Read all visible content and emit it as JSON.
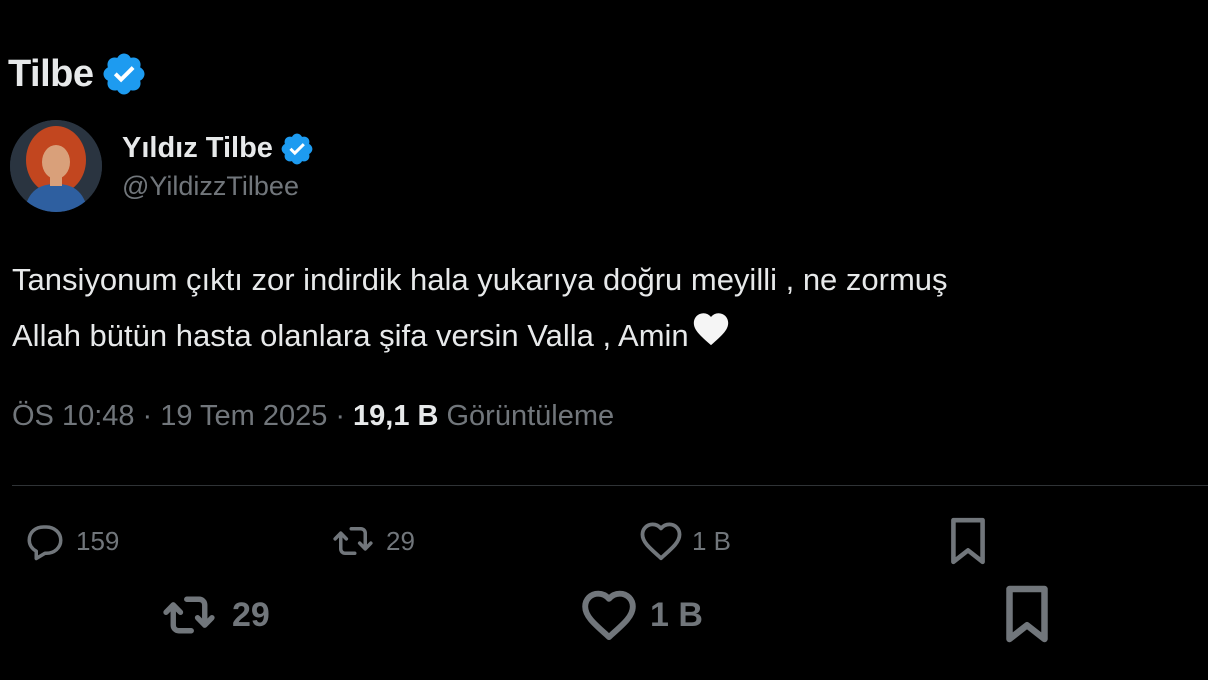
{
  "header": {
    "title": "Tilbe",
    "verified_icon": "verified-badge-icon"
  },
  "author": {
    "display_name": "Yıldız Tilbe",
    "handle": "@YildizzTilbee",
    "avatar_icon": "avatar",
    "verified_icon": "verified-badge-icon"
  },
  "tweet": {
    "line1": "Tansiyonum çıktı zor indirdik hala yukarıya doğru meyilli , ne zormuş",
    "line2": "Allah bütün hasta olanlara şifa versin Valla , Amin",
    "emoji": "white-heart-icon"
  },
  "meta": {
    "time": "ÖS 10:48",
    "separator": "·",
    "date": "19 Tem 2025",
    "views_count": "19,1 B",
    "views_label": "Görüntüleme"
  },
  "actions": {
    "reply_count": "159",
    "retweet_count": "29",
    "like_count": "1 B",
    "bookmark_icon": "bookmark-icon"
  },
  "actions_overlay": {
    "retweet_count": "29",
    "like_count": "1 B",
    "bookmark_icon": "bookmark-icon"
  },
  "colors": {
    "background": "#000000",
    "text": "#e7e9ea",
    "muted": "#71767b",
    "verified_blue": "#1d9bf0",
    "divider": "#2f3336"
  }
}
